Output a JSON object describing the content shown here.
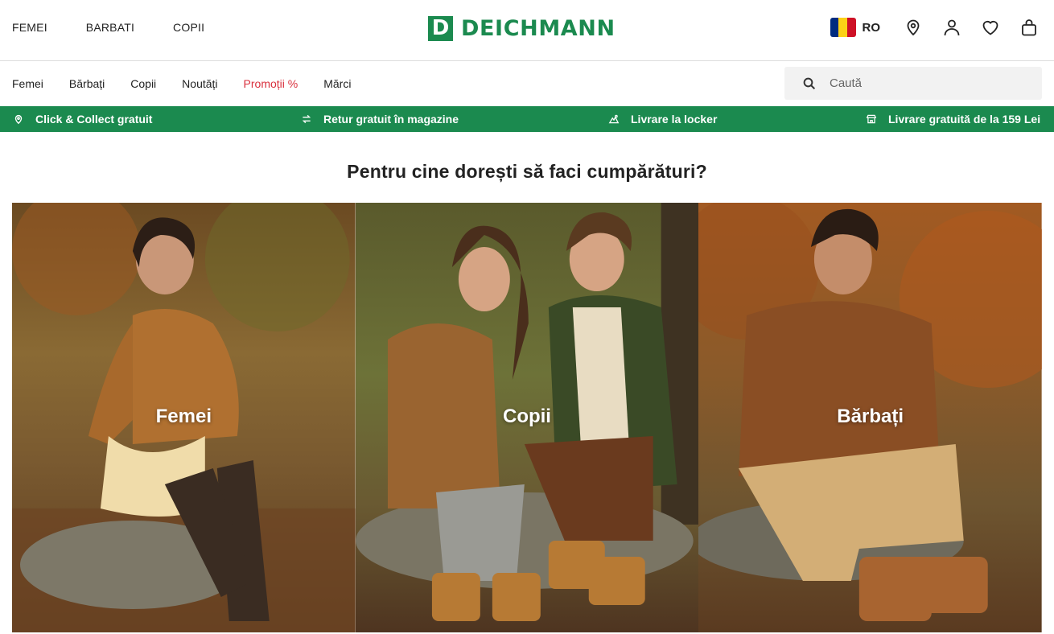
{
  "header": {
    "gender_nav": [
      "FEMEI",
      "BARBATI",
      "COPII"
    ],
    "logo": {
      "mark": "D",
      "text": "DEICHMANN"
    },
    "country": {
      "code": "RO",
      "flag_colors": [
        "#002b7f",
        "#fcd116",
        "#ce1126"
      ]
    },
    "icons": [
      "location-icon",
      "account-icon",
      "wishlist-icon",
      "cart-icon"
    ]
  },
  "category_bar": {
    "items": [
      "Femei",
      "Bărbați",
      "Copii",
      "Noutăți",
      "Promoții %",
      "Mărci"
    ],
    "promo_color": "#d9303d",
    "search_placeholder": "Caută"
  },
  "benefits": [
    {
      "label": "Click & Collect gratuit",
      "icon": "pin-icon"
    },
    {
      "label": "Retur gratuit în magazine",
      "icon": "return-icon"
    },
    {
      "label": "Livrare la locker",
      "icon": "locker-icon"
    },
    {
      "label": "Livrare gratuită de la 159 Lei",
      "icon": "store-icon"
    }
  ],
  "main": {
    "title": "Pentru cine dorești să faci cumpărături?",
    "tiles": [
      {
        "label": "Femei"
      },
      {
        "label": "Copii"
      },
      {
        "label": "Bărbați"
      }
    ]
  },
  "colors": {
    "brand_green": "#1b8a4f",
    "text": "#222222"
  }
}
